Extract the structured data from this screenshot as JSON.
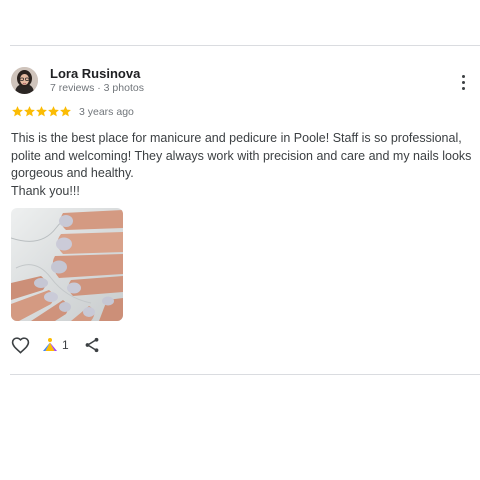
{
  "reviewer": {
    "name": "Lora Rusinova",
    "meta": "7 reviews · 3 photos"
  },
  "review": {
    "rating": 5,
    "time_ago": "3 years ago",
    "text": "This is the best place for manicure and pedicure in Poole! Staff is so professional, polite and welcoming! They always work with precision and care and my nails looks gorgeous and healthy.\nThank you!!!"
  },
  "actions": {
    "helpful_count": "1"
  },
  "colors": {
    "star": "#fbbc04",
    "text": "#3c4043",
    "secondary": "#70757a",
    "divider": "#dadce0"
  },
  "icons": [
    "avatar",
    "more-vert-icon",
    "star-icon",
    "heart-icon",
    "helpful-icon",
    "share-icon"
  ]
}
